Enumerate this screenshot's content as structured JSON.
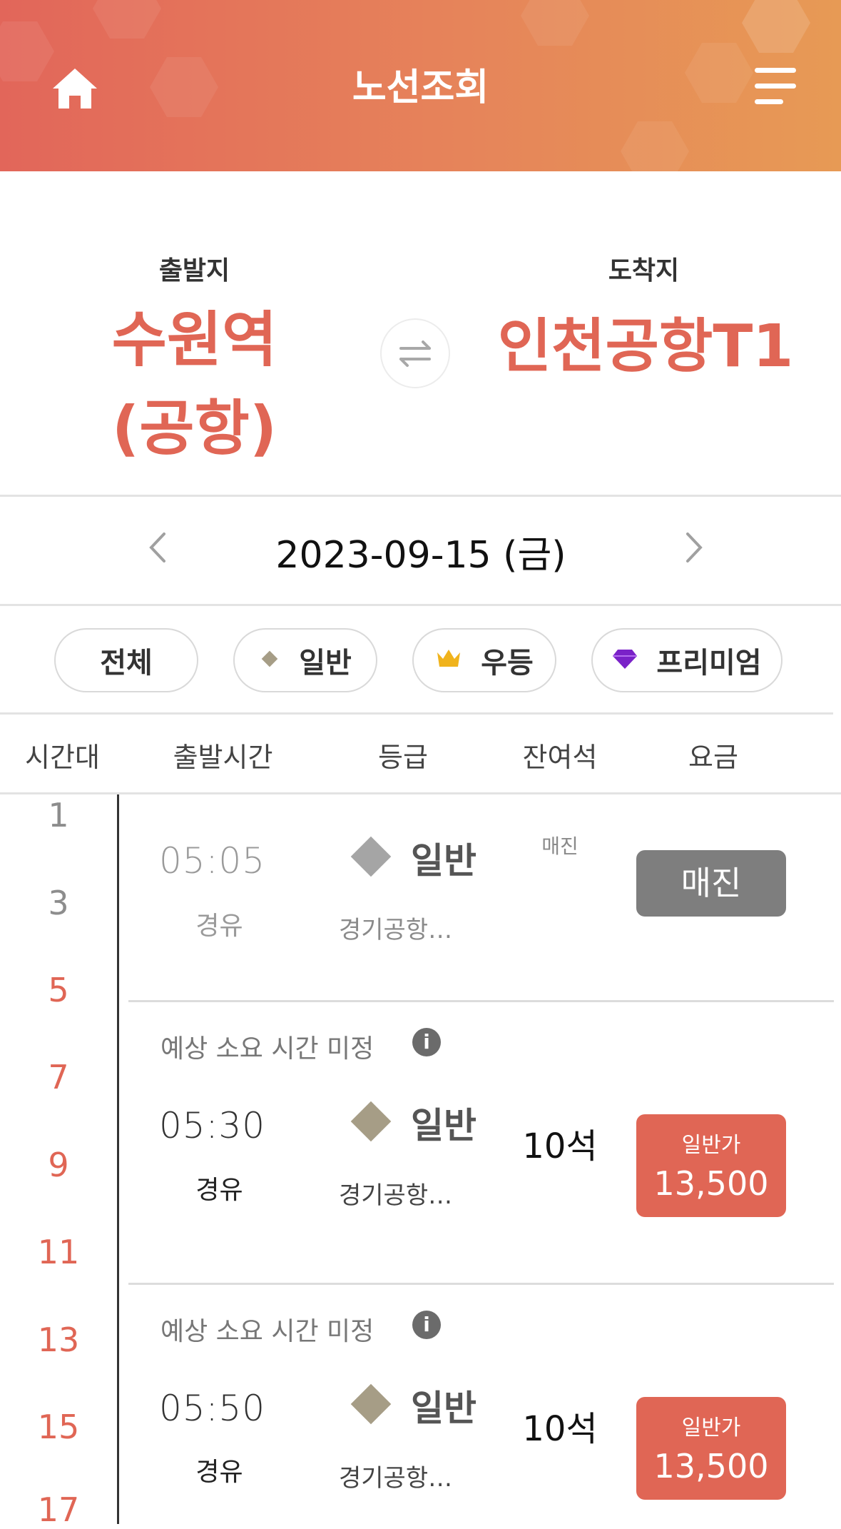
{
  "header": {
    "title": "노선조회",
    "home_icon": "home-icon",
    "menu_icon": "menu-icon"
  },
  "route": {
    "departure_label": "출발지",
    "departure_line1": "수원역",
    "departure_line2": "(공항)",
    "arrival_label": "도착지",
    "arrival": "인천공항T1",
    "swap_icon": "swap-icon"
  },
  "date": {
    "value": "2023-09-15 (금)"
  },
  "filters": [
    {
      "label": "전체",
      "icon": ""
    },
    {
      "label": "일반",
      "icon": "diamond-icon"
    },
    {
      "label": "우등",
      "icon": "crown-icon"
    },
    {
      "label": "프리미엄",
      "icon": "gem-icon"
    }
  ],
  "columns": [
    "시간대",
    "출발시간",
    "등급",
    "잔여석",
    "요금"
  ],
  "timeline": [
    "1",
    "3",
    "5",
    "7",
    "9",
    "11",
    "13",
    "15",
    "17"
  ],
  "colors": {
    "accent": "#e06655",
    "soldout": "#7e7e7e",
    "grey_text": "#9a9a9a"
  },
  "rows": [
    {
      "notice": "",
      "time": "05:05",
      "via": "경유",
      "grade": "일반",
      "grade_sub": "경기공항…",
      "seats": "매진",
      "fare_label": "",
      "fare": "매진",
      "status": "soldout"
    },
    {
      "notice": "예상 소요 시간 미정",
      "time": "05:30",
      "via": "경유",
      "grade": "일반",
      "grade_sub": "경기공항…",
      "seats": "10석",
      "fare_label": "일반가",
      "fare": "13,500",
      "status": "available"
    },
    {
      "notice": "예상 소요 시간 미정",
      "time": "05:50",
      "via": "경유",
      "grade": "일반",
      "grade_sub": "경기공항…",
      "seats": "10석",
      "fare_label": "일반가",
      "fare": "13,500",
      "status": "available"
    }
  ]
}
